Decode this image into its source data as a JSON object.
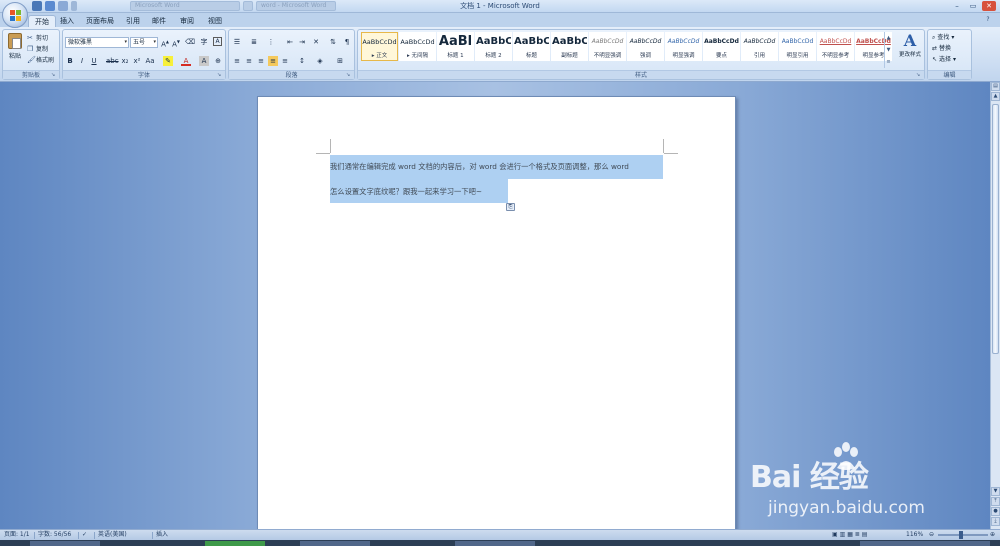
{
  "window": {
    "title": "文档 1 - Microsoft Word",
    "other_tasks": [
      "Microsoft Word",
      "",
      "word - Microsoft Word",
      "文档 1 - Microsoft Word"
    ]
  },
  "tabs": [
    "开始",
    "插入",
    "页面布局",
    "引用",
    "邮件",
    "审阅",
    "视图"
  ],
  "active_tab": "开始",
  "clipboard": {
    "paste": "粘贴",
    "cut": "剪切",
    "copy": "复制",
    "format_painter": "格式刷",
    "group_label": "剪贴板"
  },
  "font": {
    "font_name": "微软雅黑",
    "font_size": "五号",
    "group_label": "字体"
  },
  "paragraph": {
    "group_label": "段落"
  },
  "styles": {
    "group_label": "样式",
    "items": [
      {
        "sample": "AaBbCcDd",
        "name": "▸ 正文"
      },
      {
        "sample": "AaBbCcDd",
        "name": "▸ 无间隔"
      },
      {
        "sample": "AaBl",
        "name": "标题 1"
      },
      {
        "sample": "AaBbC",
        "name": "标题 2"
      },
      {
        "sample": "AaBbC",
        "name": "标题"
      },
      {
        "sample": "AaBbC",
        "name": "副标题"
      },
      {
        "sample": "AaBbCcDd",
        "name": "不明显强调"
      },
      {
        "sample": "AaBbCcDd",
        "name": "强调"
      },
      {
        "sample": "AaBbCcDd",
        "name": "明显强调"
      },
      {
        "sample": "AaBbCcDd",
        "name": "要点"
      },
      {
        "sample": "AaBbCcDd",
        "name": "引用"
      },
      {
        "sample": "AaBbCcDd",
        "name": "明显引用"
      },
      {
        "sample": "AaBbCcDd",
        "name": "不明显参考"
      },
      {
        "sample": "AaBbCcDd",
        "name": "明显参考"
      }
    ],
    "change_styles": "更改样式"
  },
  "editing": {
    "group_label": "编辑",
    "find": "查找",
    "replace": "替换",
    "select": "选择"
  },
  "document": {
    "line1": "我们通常在编辑完成 word 文档的内容后，对 word 会进行一个格式及页面调整，那么 word",
    "line2": "怎么设置文字底纹呢？跟我一起来学习一下吧~"
  },
  "status": {
    "page": "页面: 1/1",
    "words": "字数: 56/56",
    "language": "英语(美国)",
    "mode": "插入",
    "zoom": "116%"
  },
  "watermark": {
    "brand": "Bai  经验",
    "url": "jingyan.baidu.com"
  },
  "colors": {
    "selection": "#aed0f2",
    "ribbon": "#dbe7f6",
    "accent": "#2d5ea8"
  }
}
